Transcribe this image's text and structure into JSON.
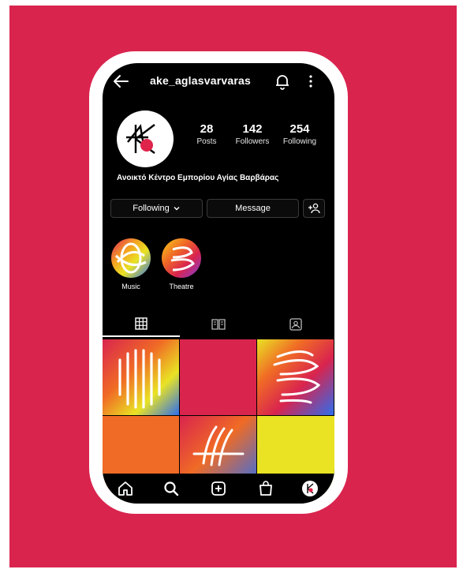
{
  "profile": {
    "username": "ake_aglasvarvaras",
    "bio_name": "Ανοικτό Κέντρο Εμπορίου Αγίας Βαρβάρας",
    "stats": [
      {
        "value": "28",
        "label": "Posts"
      },
      {
        "value": "142",
        "label": "Followers"
      },
      {
        "value": "254",
        "label": "Following"
      }
    ]
  },
  "actions": {
    "following_label": "Following",
    "message_label": "Message"
  },
  "highlights": [
    {
      "label": "Music"
    },
    {
      "label": "Theatre"
    }
  ],
  "tabs": [
    "grid-icon",
    "reels-book-icon",
    "tagged-icon"
  ],
  "nav": [
    "home-icon",
    "search-icon",
    "create-icon",
    "shop-icon",
    "profile-avatar-icon"
  ],
  "colors": {
    "background": "#d9244e",
    "screen": "#000000",
    "grid_red": "#d9244e",
    "grid_orange": "#f06b25",
    "grid_yellow": "#e9e324"
  }
}
